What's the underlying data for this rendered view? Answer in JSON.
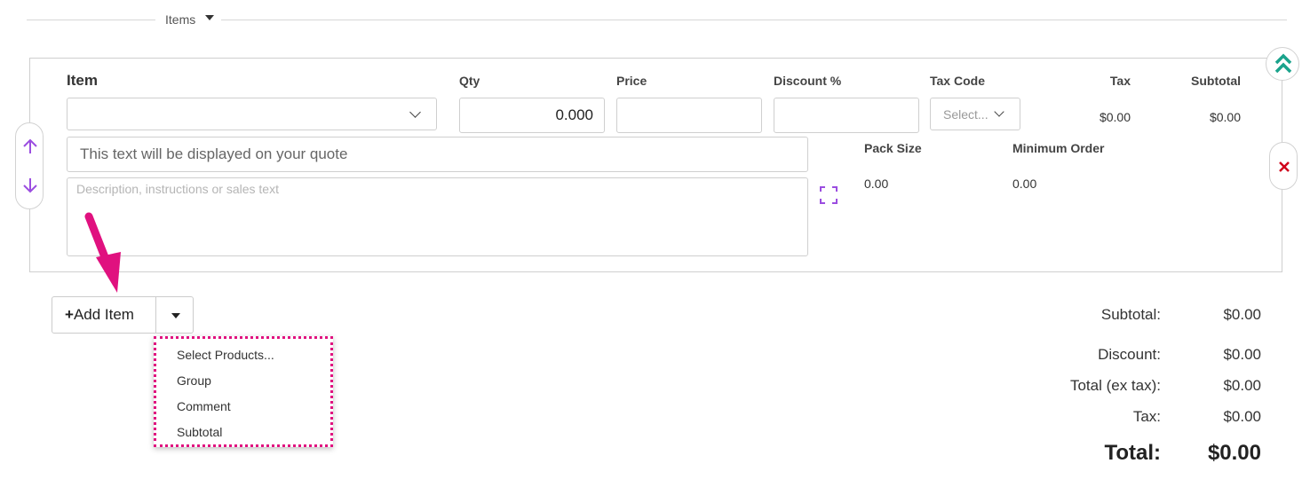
{
  "section": {
    "title": "Items"
  },
  "line_item": {
    "headers": {
      "item": "Item",
      "qty": "Qty",
      "price": "Price",
      "discount": "Discount %",
      "tax_code": "Tax Code",
      "tax": "Tax",
      "subtotal": "Subtotal"
    },
    "qty_value": "0.000",
    "tax_code_placeholder": "Select...",
    "tax_value": "$0.00",
    "subtotal_value": "$0.00",
    "quote_text_placeholder": "This text will be displayed on your quote",
    "description_placeholder": "Description, instructions or sales text",
    "pack_size_label": "Pack Size",
    "pack_size_value": "0.00",
    "minimum_order_label": "Minimum Order",
    "minimum_order_value": "0.00"
  },
  "add_item": {
    "label": "Add Item",
    "menu": [
      "Select Products...",
      "Group",
      "Comment",
      "Subtotal"
    ]
  },
  "totals": {
    "subtotal_label": "Subtotal:",
    "subtotal_value": "$0.00",
    "discount_label": "Discount:",
    "discount_value": "$0.00",
    "total_ex_tax_label": "Total (ex tax):",
    "total_ex_tax_value": "$0.00",
    "tax_label": "Tax:",
    "tax_value": "$0.00",
    "total_label": "Total:",
    "total_value": "$0.00"
  },
  "colors": {
    "accent_teal": "#1aa38c",
    "accent_purple": "#9b4de0",
    "delete_red": "#d0021b",
    "annotation_pink": "#e0117f"
  },
  "icons": [
    "chevron-double-up-icon",
    "arrow-up-icon",
    "arrow-down-icon",
    "close-icon",
    "expand-icon",
    "chevron-down-icon",
    "plus-icon",
    "caret-down-icon",
    "annotation-arrow-icon"
  ]
}
